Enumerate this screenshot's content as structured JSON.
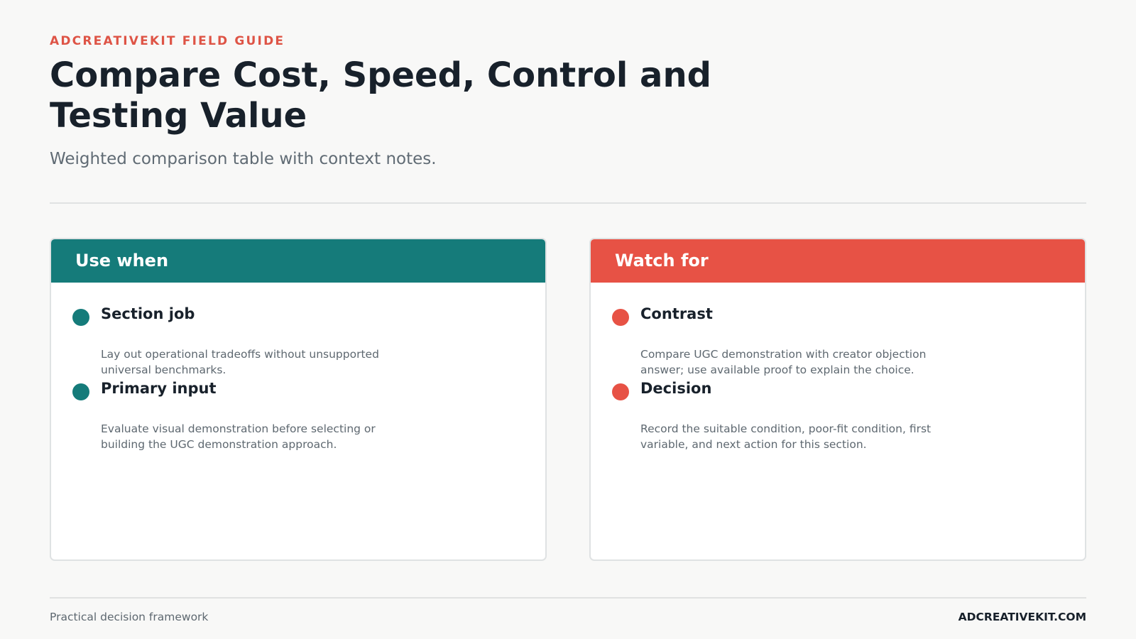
{
  "header": {
    "eyebrow": "ADCREATIVEKIT FIELD GUIDE",
    "title": "Compare Cost, Speed, Control and Testing Value",
    "subtitle": "Weighted comparison table with context notes."
  },
  "cards": [
    {
      "heading": "Use when",
      "color": "#157b7a",
      "items": [
        {
          "title": "Section job",
          "text": "Lay out operational tradeoffs without unsupported universal benchmarks."
        },
        {
          "title": "Primary input",
          "text": "Evaluate visual demonstration before selecting or building the UGC demonstration approach."
        }
      ]
    },
    {
      "heading": "Watch for",
      "color": "#e75245",
      "items": [
        {
          "title": "Contrast",
          "text": "Compare UGC demonstration with creator objection answer; use available proof to explain the choice."
        },
        {
          "title": "Decision",
          "text": "Record the suitable condition, poor-fit condition, first variable, and next action for this section."
        }
      ]
    }
  ],
  "footer": {
    "left": "Practical decision framework",
    "right": "ADCREATIVEKIT.COM"
  },
  "colors": {
    "accent": "#de5446",
    "teal": "#157b7a",
    "coral": "#e75245",
    "text": "#18212b",
    "muted": "#5e6870",
    "background": "#f8f8f7"
  }
}
